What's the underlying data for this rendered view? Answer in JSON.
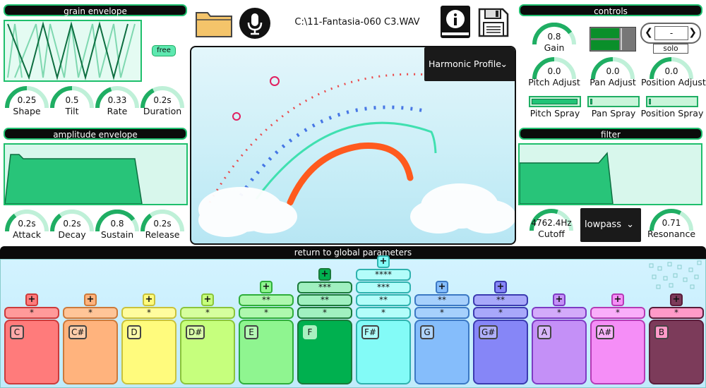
{
  "grain": {
    "title": "grain envelope",
    "free": "free",
    "knobs": [
      {
        "value": "0.25",
        "label": "Shape",
        "fill": 0.5
      },
      {
        "value": "0.5",
        "label": "Tilt",
        "fill": 0.5
      },
      {
        "value": "0.33",
        "label": "Rate",
        "fill": 0.4
      },
      {
        "value": "0.2s",
        "label": "Duration",
        "fill": 0.35
      }
    ]
  },
  "amp": {
    "title": "amplitude envelope",
    "knobs": [
      {
        "value": "0.2s",
        "label": "Attack",
        "fill": 0.3
      },
      {
        "value": "0.2s",
        "label": "Decay",
        "fill": 0.3
      },
      {
        "value": "0.8",
        "label": "Sustain",
        "fill": 0.8
      },
      {
        "value": "0.2s",
        "label": "Release",
        "fill": 0.3
      }
    ]
  },
  "file": {
    "path": "C:\\11-Fantasia-060 C3.WAV"
  },
  "view": {
    "profile": "Harmonic Profile"
  },
  "controls": {
    "title": "controls",
    "gain": {
      "value": "0.8",
      "label": "Gain",
      "fill": 0.8
    },
    "selector": "-",
    "solo": "solo",
    "knobs": [
      {
        "value": "0.0",
        "label": "Pitch Adjust",
        "fill": 0.5
      },
      {
        "value": "0.0",
        "label": "Pan Adjust",
        "fill": 0.5
      },
      {
        "value": "0.0",
        "label": "Position Adjust",
        "fill": 0.5
      }
    ],
    "sprays": [
      {
        "label": "Pitch Spray",
        "level": 0.95
      },
      {
        "label": "Pan Spray",
        "level": 0.04
      },
      {
        "label": "Position Spray",
        "level": 0.04
      }
    ]
  },
  "filter": {
    "title": "filter",
    "cutoff": {
      "value": "4762.4Hz",
      "label": "Cutoff",
      "fill": 0.6
    },
    "type": "lowpass",
    "resonance": {
      "value": "0.71",
      "label": "Resonance",
      "fill": 0.65
    }
  },
  "global": {
    "label": "return to global parameters"
  },
  "keys": [
    {
      "note": "C",
      "stars": [
        "*"
      ],
      "color": "#ff7b7b",
      "border": "#cc3b3b",
      "light": "#ff9a9a"
    },
    {
      "note": "C#",
      "stars": [
        "*"
      ],
      "color": "#ffb37d",
      "border": "#cc7a3b",
      "light": "#ffc598"
    },
    {
      "note": "D",
      "stars": [
        "*"
      ],
      "color": "#fffb7d",
      "border": "#c9c23b",
      "light": "#fffc9e"
    },
    {
      "note": "D#",
      "stars": [
        "*"
      ],
      "color": "#c6ff7d",
      "border": "#8bc43b",
      "light": "#d6ff9e"
    },
    {
      "note": "E",
      "stars": [
        "**",
        "*"
      ],
      "color": "#8ff590",
      "border": "#2fae3a",
      "light": "#aef8ae"
    },
    {
      "note": "F",
      "stars": [
        "***",
        "**",
        "*"
      ],
      "color": "#00b04f",
      "border": "#1a7a3a",
      "light": "#a0f0c0"
    },
    {
      "note": "F#",
      "stars": [
        "****",
        "***",
        "**",
        "*"
      ],
      "color": "#83fbf7",
      "border": "#2fb2ae",
      "light": "#b3fdfa"
    },
    {
      "note": "G",
      "stars": [
        "**",
        "*"
      ],
      "color": "#85bdfb",
      "border": "#3b78c4",
      "light": "#a6d0fc"
    },
    {
      "note": "G#",
      "stars": [
        "**",
        "*"
      ],
      "color": "#8686f7",
      "border": "#3b3bb0",
      "light": "#a8a8fa"
    },
    {
      "note": "A",
      "stars": [
        "*"
      ],
      "color": "#c490f7",
      "border": "#7e3bc4",
      "light": "#d3abfa"
    },
    {
      "note": "A#",
      "stars": [
        "*"
      ],
      "color": "#f58ef7",
      "border": "#b53bb5",
      "light": "#f9aefa"
    },
    {
      "note": "B",
      "stars": [
        "*"
      ],
      "color": "#7c3b5a",
      "border": "#5a1c3a",
      "light": "#ff9ac8"
    }
  ],
  "icons": {
    "folder": "folder-icon",
    "mic": "microphone-icon",
    "info": "info-icon",
    "save": "save-icon"
  }
}
